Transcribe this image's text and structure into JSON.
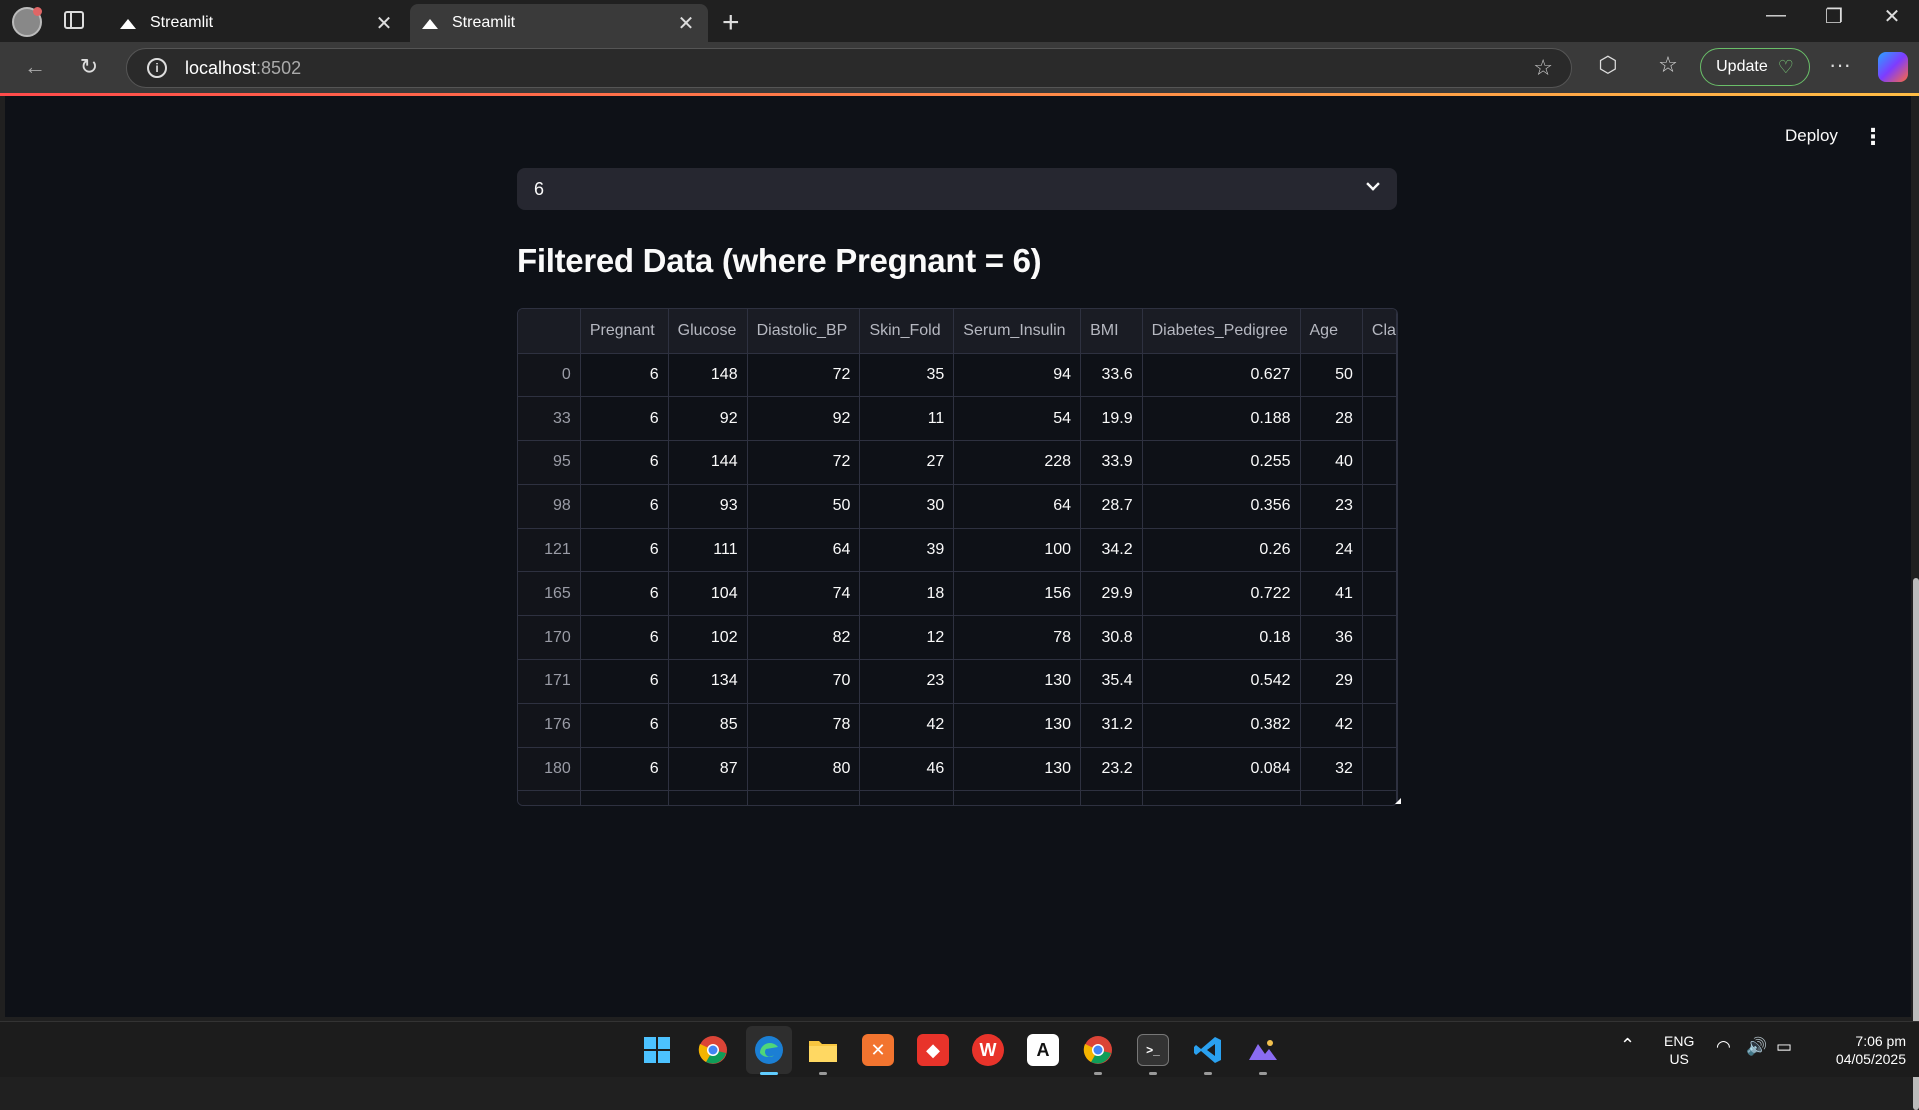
{
  "browser": {
    "tabs": [
      {
        "label": "Streamlit"
      },
      {
        "label": "Streamlit"
      }
    ],
    "url_host": "localhost",
    "url_port": ":8502",
    "update_label": "Update"
  },
  "app": {
    "deploy_label": "Deploy",
    "select_value": "6",
    "subtitle": "Filtered Data (where Pregnant = 6)",
    "columns": [
      "",
      "Pregnant",
      "Glucose",
      "Diastolic_BP",
      "Skin_Fold",
      "Serum_Insulin",
      "BMI",
      "Diabetes_Pedigree",
      "Age",
      "Cla"
    ],
    "rows": [
      [
        "0",
        "6",
        "148",
        "72",
        "35",
        "94",
        "33.6",
        "0.627",
        "50",
        ""
      ],
      [
        "33",
        "6",
        "92",
        "92",
        "11",
        "54",
        "19.9",
        "0.188",
        "28",
        ""
      ],
      [
        "95",
        "6",
        "144",
        "72",
        "27",
        "228",
        "33.9",
        "0.255",
        "40",
        ""
      ],
      [
        "98",
        "6",
        "93",
        "50",
        "30",
        "64",
        "28.7",
        "0.356",
        "23",
        ""
      ],
      [
        "121",
        "6",
        "111",
        "64",
        "39",
        "100",
        "34.2",
        "0.26",
        "24",
        ""
      ],
      [
        "165",
        "6",
        "104",
        "74",
        "18",
        "156",
        "29.9",
        "0.722",
        "41",
        ""
      ],
      [
        "170",
        "6",
        "102",
        "82",
        "12",
        "78",
        "30.8",
        "0.18",
        "36",
        ""
      ],
      [
        "171",
        "6",
        "134",
        "70",
        "23",
        "130",
        "35.4",
        "0.542",
        "29",
        ""
      ],
      [
        "176",
        "6",
        "85",
        "78",
        "42",
        "130",
        "31.2",
        "0.382",
        "42",
        ""
      ],
      [
        "180",
        "6",
        "87",
        "80",
        "46",
        "130",
        "23.2",
        "0.084",
        "32",
        ""
      ],
      [
        "",
        "",
        "",
        "",
        "",
        "",
        "",
        "",
        "",
        ""
      ]
    ]
  },
  "taskbar": {
    "lang_line1": "ENG",
    "lang_line2": "US",
    "time": "7:06 pm",
    "date": "04/05/2025"
  }
}
